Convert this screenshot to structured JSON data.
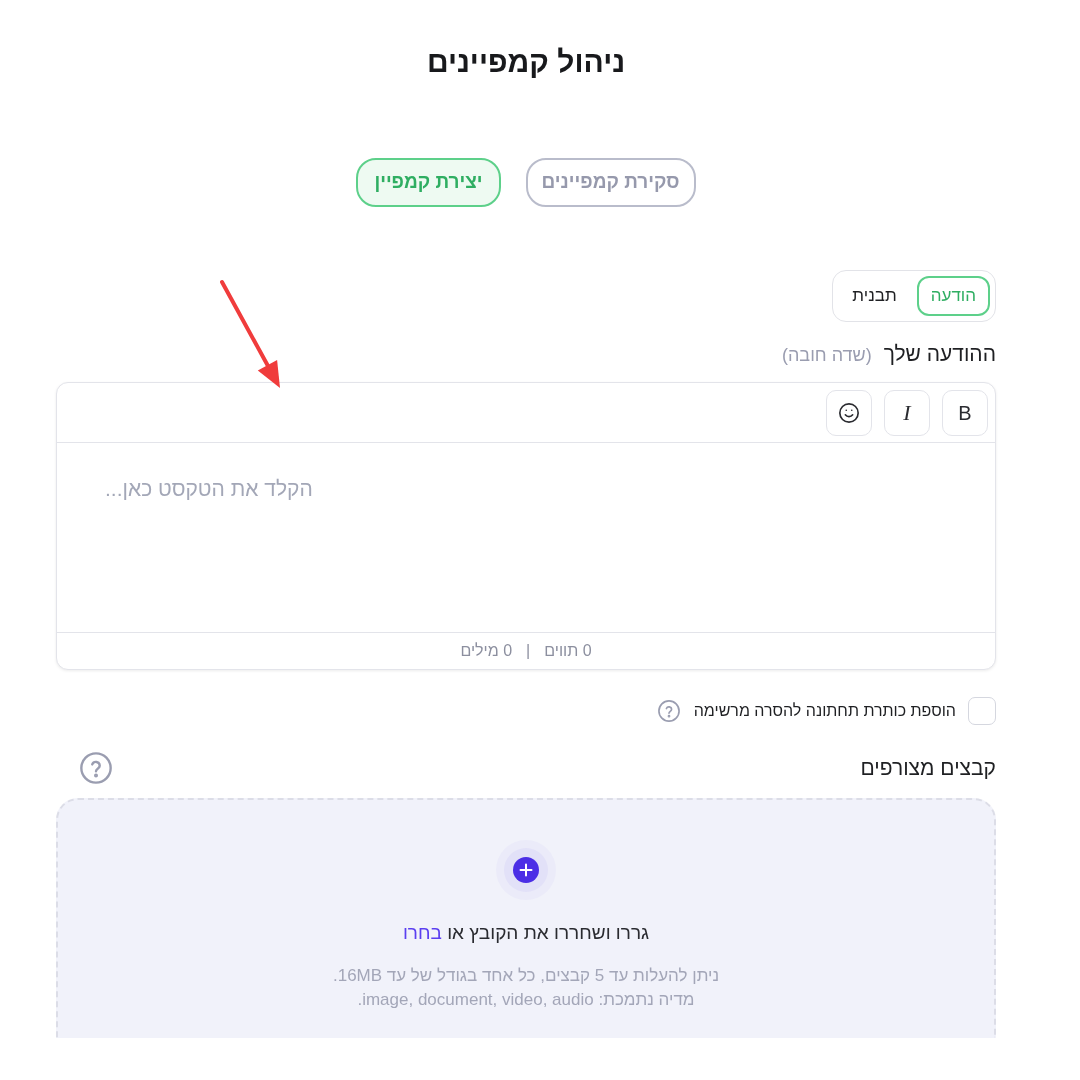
{
  "page": {
    "title": "ניהול קמפיינים"
  },
  "tabs": [
    {
      "label": "סקירת קמפיינים",
      "selected": false
    },
    {
      "label": "יצירת קמפיין",
      "selected": true
    }
  ],
  "message_type": [
    {
      "label": "הודעה",
      "selected": true
    },
    {
      "label": "תבנית",
      "selected": false
    }
  ],
  "message_field": {
    "label": "ההודעה שלך",
    "hint": "(שדה חובה)",
    "toolbar": [
      {
        "kind": "bold",
        "label": "B"
      },
      {
        "kind": "italic",
        "label": "I"
      },
      {
        "kind": "emoji"
      }
    ],
    "placeholder": "הקלד את הטקסט כאן...",
    "counters": [
      "0 תווים",
      "0 מילים"
    ],
    "separator": "|"
  },
  "footer_option": {
    "label": "הוספת כותרת תחתונה להסרה מרשימה",
    "checked": false
  },
  "attachments": {
    "label": "קבצים מצורפים",
    "drop_text": "גררו ושחררו את הקובץ או",
    "browse_link": "בחרו",
    "limits": [
      "ניתן להעלות עד 5 קבצים, כל אחד בגודל של עד 16MB.",
      "מדיה נתמכת: image, document, video, audio."
    ]
  }
}
